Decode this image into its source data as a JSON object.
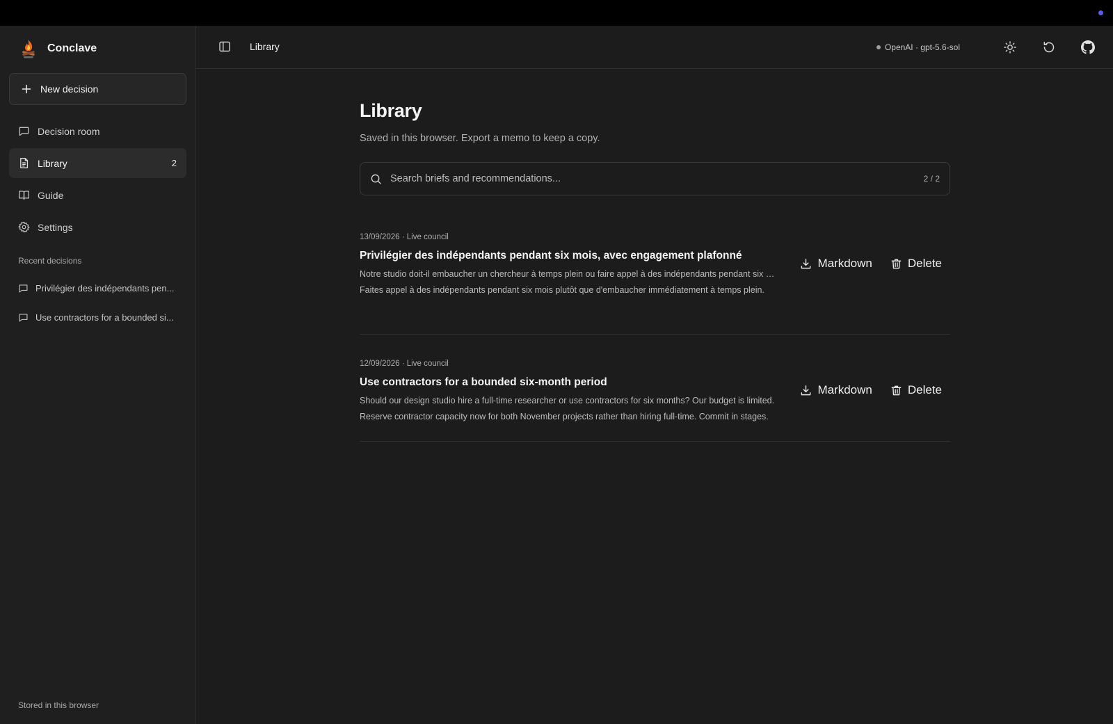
{
  "app": {
    "name": "Conclave",
    "new_decision_label": "New decision",
    "storage_note": "Stored in this browser"
  },
  "nav": {
    "items": [
      {
        "label": "Decision room",
        "icon": "message-square-icon"
      },
      {
        "label": "Library",
        "icon": "file-text-icon",
        "count": "2",
        "active": true
      },
      {
        "label": "Guide",
        "icon": "book-open-icon"
      },
      {
        "label": "Settings",
        "icon": "gear-icon"
      }
    ]
  },
  "recent": {
    "label": "Recent decisions",
    "items": [
      "Privilégier des indépendants pen...",
      "Use contractors for a bounded si..."
    ]
  },
  "header": {
    "title": "Library",
    "model": "OpenAI · gpt-5.6-sol"
  },
  "page": {
    "title": "Library",
    "subtitle": "Saved in this browser. Export a memo to keep a copy."
  },
  "search": {
    "placeholder": "Search briefs and recommendations...",
    "value": "",
    "count": "2 / 2"
  },
  "entries": [
    {
      "meta": "13/09/2026 · Live council",
      "title": "Privilégier des indépendants pendant six mois, avec engagement plafonné",
      "brief": "Notre studio doit-il embaucher un chercheur à temps plein ou faire appel à des indépendants pendant six mois ?",
      "recommendation": "Faites appel à des indépendants pendant six mois plutôt que d'embaucher immédiatement à temps plein.",
      "markdown_label": "Markdown",
      "delete_label": "Delete"
    },
    {
      "meta": "12/09/2026 · Live council",
      "title": "Use contractors for a bounded six-month period",
      "brief": "Should our design studio hire a full-time researcher or use contractors for six months? Our budget is limited.",
      "recommendation": "Reserve contractor capacity now for both November projects rather than hiring full-time. Commit in stages.",
      "markdown_label": "Markdown",
      "delete_label": "Delete"
    }
  ],
  "colors": {
    "background": "#1c1c1c",
    "sidebar": "#1f1f1f",
    "active_nav": "#2c2c2c",
    "accent_dot": "#5b5bf0"
  }
}
